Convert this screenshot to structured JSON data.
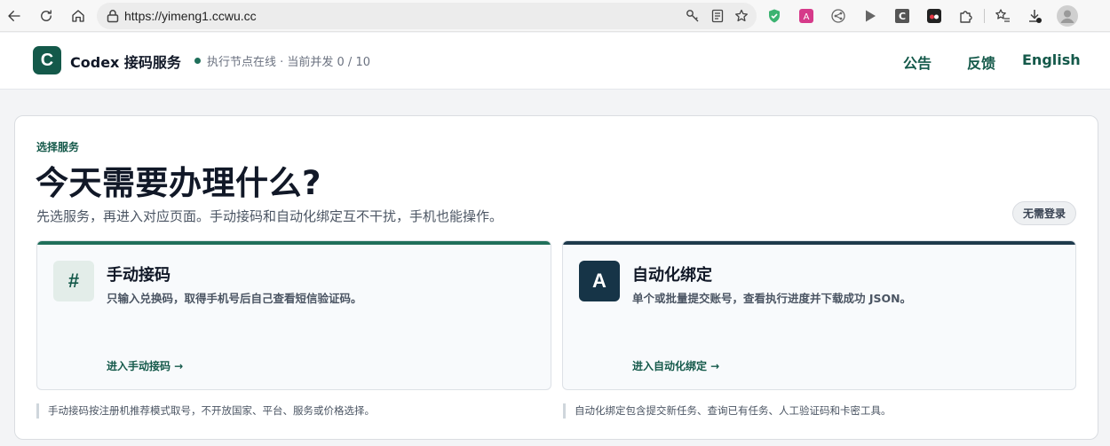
{
  "browser": {
    "url": "https://yimeng1.ccwu.cc"
  },
  "header": {
    "logo_letter": "C",
    "brand": "Codex 接码服务",
    "status": "执行节点在线 · 当前并发 0 / 10",
    "nav": [
      "公告",
      "反馈",
      "English"
    ]
  },
  "main": {
    "eyebrow": "选择服务",
    "headline": "今天需要办理什么?",
    "subtitle": "先选服务，再进入对应页面。手动接码和自动化绑定互不干扰，手机也能操作。",
    "login_pill": "无需登录",
    "services": [
      {
        "badge": "#",
        "title": "手动接码",
        "description": "只输入兑换码，取得手机号后自己查看短信验证码。",
        "link": "进入手动接码 →",
        "note": "手动接码按注册机推荐模式取号，不开放国家、平台、服务或价格选择。"
      },
      {
        "badge": "A",
        "title": "自动化绑定",
        "description": "单个或批量提交账号，查看执行进度并下载成功 JSON。",
        "link": "进入自动化绑定 →",
        "note": "自动化绑定包含提交新任务、查询已有任务、人工验证码和卡密工具。"
      }
    ]
  },
  "colors": {
    "brand": "#14594a",
    "manual_bar": "#1f6f5a",
    "auto_bar": "#1e3a4c",
    "auto_badge": "#163447"
  }
}
